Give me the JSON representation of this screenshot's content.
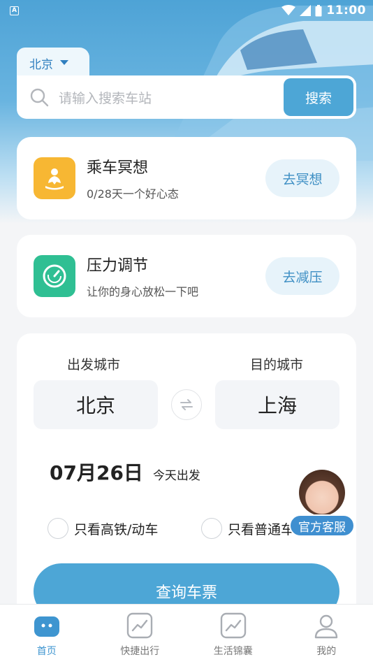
{
  "status_bar": {
    "time": "11:00"
  },
  "search": {
    "city": "北京",
    "placeholder": "请输入搜索车站",
    "button_label": "搜索"
  },
  "features": [
    {
      "title": "乘车冥想",
      "subtitle": "0/28天一个好心态",
      "button_label": "去冥想",
      "icon": "meditation-icon",
      "color": "#f7b733"
    },
    {
      "title": "压力调节",
      "subtitle": "让你的身心放松一下吧",
      "button_label": "去减压",
      "icon": "gauge-icon",
      "color": "#2fbf93"
    }
  ],
  "booking": {
    "from_label": "出发城市",
    "to_label": "目的城市",
    "from_city": "北京",
    "to_city": "上海",
    "date": "07月26日",
    "date_hint": "今天出发",
    "option_high_speed": "只看高铁/动车",
    "option_regular": "只看普通车",
    "query_button": "查询车票"
  },
  "customer_service": {
    "label": "官方客服"
  },
  "tabbar": {
    "items": [
      {
        "label": "首页",
        "icon": "home-icon",
        "active": true
      },
      {
        "label": "快捷出行",
        "icon": "trend-icon",
        "active": false
      },
      {
        "label": "生活锦囊",
        "icon": "trend-icon",
        "active": false
      },
      {
        "label": "我的",
        "icon": "user-icon",
        "active": false
      }
    ]
  },
  "colors": {
    "accent": "#4da6d6",
    "active_tab": "#3e95d0"
  }
}
